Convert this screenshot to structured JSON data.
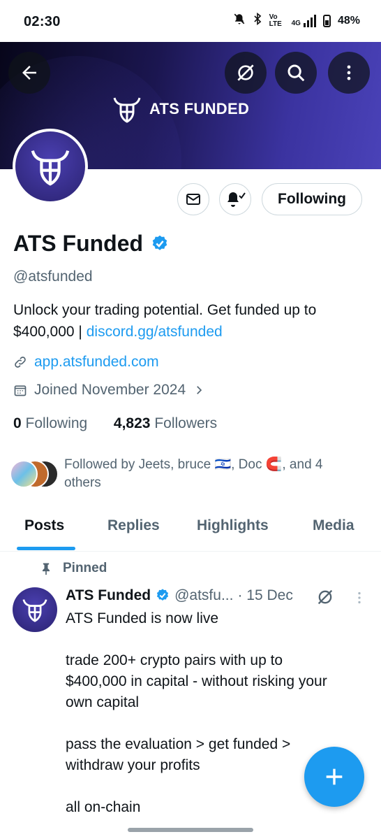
{
  "status_bar": {
    "time": "02:30",
    "signal_text": "Vo LTE",
    "network": "4G",
    "battery": "48%"
  },
  "banner": {
    "brand_text": "ATS FUNDED"
  },
  "profile": {
    "name": "ATS Funded",
    "handle": "@atsfunded",
    "bio_text": "Unlock your trading potential. Get funded up to $400,000 | ",
    "bio_link": "discord.gg/atsfunded",
    "website": "app.atsfunded.com",
    "joined": "Joined November 2024",
    "following_count": "0",
    "following_label": " Following",
    "followers_count": "4,823",
    "followers_label": " Followers",
    "followed_by": "Followed by Jeets, bruce 🇮🇱, Doc 🧲, and 4 others"
  },
  "actions": {
    "following_label": "Following"
  },
  "tabs": [
    {
      "label": "Posts"
    },
    {
      "label": "Replies"
    },
    {
      "label": "Highlights"
    },
    {
      "label": "Media"
    }
  ],
  "pinned_post": {
    "pinned_label": "Pinned",
    "author_name": "ATS Funded",
    "author_handle": "@atsfu...",
    "date": "· 15 Dec",
    "text": "ATS Funded is now live\n\ntrade 200+ crypto pairs with up to $400,000 in capital - without risking your own capital\n\npass the evaluation > get funded > withdraw your profits\n\nall on-chain"
  },
  "colors": {
    "accent": "#1d9bf0",
    "text_primary": "#0f1419",
    "text_secondary": "#536471",
    "banner_dark": "#07061a",
    "banner_light": "#4a42b8"
  }
}
